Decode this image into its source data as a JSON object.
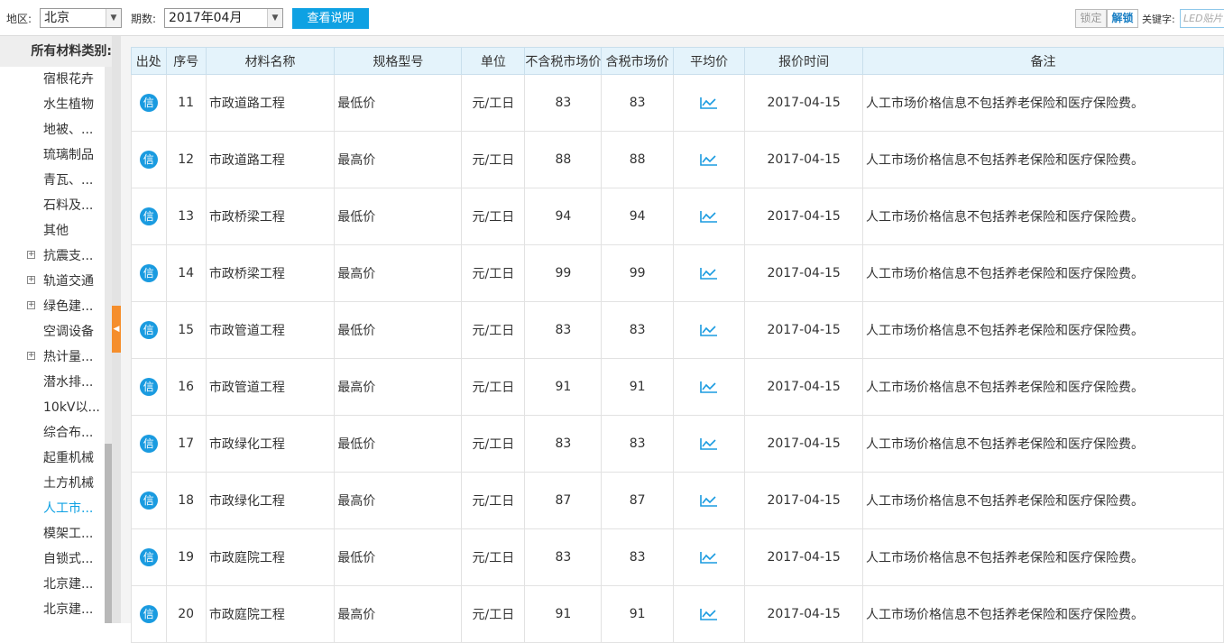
{
  "toolbar": {
    "region_label": "地区:",
    "region_value": "北京",
    "period_label": "期数:",
    "period_value": "2017年04月",
    "help_button": "查看说明",
    "lock_button": "锁定",
    "unlock_button": "解锁",
    "keyword_label": "关键字:",
    "keyword_placeholder": "LED贴片"
  },
  "sidebar": {
    "title": "所有材料类别:",
    "items": [
      {
        "label": "宿根花卉",
        "expandable": false
      },
      {
        "label": "水生植物",
        "expandable": false
      },
      {
        "label": "地被、...",
        "expandable": false
      },
      {
        "label": "琉璃制品",
        "expandable": false
      },
      {
        "label": "青瓦、...",
        "expandable": false
      },
      {
        "label": "石料及...",
        "expandable": false
      },
      {
        "label": "其他",
        "expandable": false
      },
      {
        "label": "抗震支...",
        "expandable": true
      },
      {
        "label": "轨道交通",
        "expandable": true
      },
      {
        "label": "绿色建...",
        "expandable": true
      },
      {
        "label": "空调设备",
        "expandable": false
      },
      {
        "label": "热计量...",
        "expandable": true
      },
      {
        "label": "潜水排...",
        "expandable": false
      },
      {
        "label": "10kV以...",
        "expandable": false
      },
      {
        "label": "综合布...",
        "expandable": false
      },
      {
        "label": "起重机械",
        "expandable": false
      },
      {
        "label": "土方机械",
        "expandable": false
      },
      {
        "label": "人工市...",
        "expandable": false,
        "active": true
      },
      {
        "label": "模架工...",
        "expandable": false
      },
      {
        "label": "自锁式...",
        "expandable": false
      },
      {
        "label": "北京建...",
        "expandable": false
      },
      {
        "label": "北京建...",
        "expandable": false
      }
    ]
  },
  "table": {
    "headers": [
      "出处",
      "序号",
      "材料名称",
      "规格型号",
      "单位",
      "不含税市场价",
      "含税市场价",
      "平均价",
      "报价时间",
      "备注"
    ],
    "source_icon_text": "信",
    "rows": [
      {
        "no": "11",
        "name": "市政道路工程",
        "spec": "最低价",
        "unit": "元/工日",
        "price_ex": "83",
        "price_in": "83",
        "date": "2017-04-15",
        "note": "人工市场价格信息不包括养老保险和医疗保险费。"
      },
      {
        "no": "12",
        "name": "市政道路工程",
        "spec": "最高价",
        "unit": "元/工日",
        "price_ex": "88",
        "price_in": "88",
        "date": "2017-04-15",
        "note": "人工市场价格信息不包括养老保险和医疗保险费。"
      },
      {
        "no": "13",
        "name": "市政桥梁工程",
        "spec": "最低价",
        "unit": "元/工日",
        "price_ex": "94",
        "price_in": "94",
        "date": "2017-04-15",
        "note": "人工市场价格信息不包括养老保险和医疗保险费。"
      },
      {
        "no": "14",
        "name": "市政桥梁工程",
        "spec": "最高价",
        "unit": "元/工日",
        "price_ex": "99",
        "price_in": "99",
        "date": "2017-04-15",
        "note": "人工市场价格信息不包括养老保险和医疗保险费。"
      },
      {
        "no": "15",
        "name": "市政管道工程",
        "spec": "最低价",
        "unit": "元/工日",
        "price_ex": "83",
        "price_in": "83",
        "date": "2017-04-15",
        "note": "人工市场价格信息不包括养老保险和医疗保险费。"
      },
      {
        "no": "16",
        "name": "市政管道工程",
        "spec": "最高价",
        "unit": "元/工日",
        "price_ex": "91",
        "price_in": "91",
        "date": "2017-04-15",
        "note": "人工市场价格信息不包括养老保险和医疗保险费。"
      },
      {
        "no": "17",
        "name": "市政绿化工程",
        "spec": "最低价",
        "unit": "元/工日",
        "price_ex": "83",
        "price_in": "83",
        "date": "2017-04-15",
        "note": "人工市场价格信息不包括养老保险和医疗保险费。"
      },
      {
        "no": "18",
        "name": "市政绿化工程",
        "spec": "最高价",
        "unit": "元/工日",
        "price_ex": "87",
        "price_in": "87",
        "date": "2017-04-15",
        "note": "人工市场价格信息不包括养老保险和医疗保险费。"
      },
      {
        "no": "19",
        "name": "市政庭院工程",
        "spec": "最低价",
        "unit": "元/工日",
        "price_ex": "83",
        "price_in": "83",
        "date": "2017-04-15",
        "note": "人工市场价格信息不包括养老保险和医疗保险费。"
      },
      {
        "no": "20",
        "name": "市政庭院工程",
        "spec": "最高价",
        "unit": "元/工日",
        "price_ex": "91",
        "price_in": "91",
        "date": "2017-04-15",
        "note": "人工市场价格信息不包括养老保险和医疗保险费。"
      }
    ]
  },
  "colors": {
    "accent": "#0ea1e3",
    "collapse_tab": "#f58e2c",
    "header_bg": "#e4f3fb"
  }
}
